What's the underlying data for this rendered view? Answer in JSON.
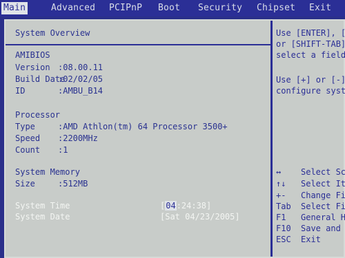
{
  "menu": {
    "tabs": [
      {
        "label": "Main",
        "active": true
      },
      {
        "label": "Advanced"
      },
      {
        "label": "PCIPnP"
      },
      {
        "label": "Boot"
      },
      {
        "label": "Security"
      },
      {
        "label": "Chipset"
      },
      {
        "label": "Exit"
      }
    ]
  },
  "main": {
    "title": "System Overview",
    "amibios": {
      "heading": "AMIBIOS",
      "version_label": "Version",
      "version_value": ":08.00.11",
      "build_date_label": "Build Date",
      "build_date_value": ":02/02/05",
      "id_label": "ID",
      "id_value": ":AMBU_B14"
    },
    "processor": {
      "heading": "Processor",
      "type_label": "Type",
      "type_value": ":AMD Athlon(tm) 64 Processor 3500+",
      "speed_label": "Speed",
      "speed_value": ":2200MHz",
      "count_label": "Count",
      "count_value": ":1"
    },
    "memory": {
      "heading": "System Memory",
      "size_label": "Size",
      "size_value": ":512MB"
    },
    "time": {
      "label": "System Time",
      "value_open": "[",
      "value_cursor": "04",
      "value_rest": ":24:38]"
    },
    "date": {
      "label": "System Date",
      "value": "[Sat 04/23/2005]"
    }
  },
  "help": {
    "lines": [
      "Use [ENTER], [T",
      "or [SHIFT-TAB]",
      "select a field.",
      "",
      "Use [+] or [-]",
      "configure syste"
    ],
    "keys": [
      {
        "key": "↔",
        "desc": "Select Sc"
      },
      {
        "key": "↑↓",
        "desc": "Select Ite"
      },
      {
        "key": "+-",
        "desc": "Change Fie"
      },
      {
        "key": "Tab",
        "desc": "Select Fie"
      },
      {
        "key": "F1",
        "desc": "General He"
      },
      {
        "key": "F10",
        "desc": "Save and Ex"
      },
      {
        "key": "ESC",
        "desc": "Exit"
      }
    ]
  },
  "colors": {
    "frame": "#2b2f96",
    "panel": "#c8ccc9",
    "text": "#2a3290",
    "highlight": "#f3f5f2"
  }
}
